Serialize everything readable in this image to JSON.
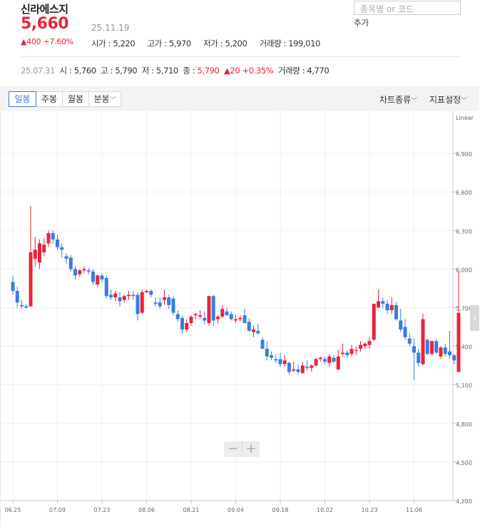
{
  "stock": {
    "name": "신라에스지",
    "price": "5,660",
    "date": "25.11.19",
    "change": "▲400 +7.60%",
    "open": "시가 : 5,220",
    "high": "고가 : 5,970",
    "low": "저가 : 5,200",
    "volume": "거래량 : 199,010"
  },
  "search": {
    "placeholder": "종목명 or 코드",
    "add_label": "추가"
  },
  "recent": {
    "date": "25.07.31",
    "open": "시 : 5,760",
    "high": "고 : 5,790",
    "low": "저 : 5,710",
    "close_label": "종 : ",
    "close_value": "5,790",
    "change": "▲20 +0.35%",
    "volume": "거래량 : 4,770"
  },
  "tabs": [
    "일봉",
    "주봉",
    "월봉",
    "분봉"
  ],
  "tools": {
    "chart_type": "차트종류",
    "indicators": "지표설정"
  },
  "zoom": {
    "out": "−",
    "in": "+"
  },
  "colors": {
    "up": "#e8243b",
    "down": "#3a7ddf",
    "accent": "#3c7bd8"
  },
  "chart_data": {
    "type": "candlestick",
    "scale_label": "Linear",
    "ylim": [
      4200,
      7200
    ],
    "yticks": [
      4200,
      4500,
      4800,
      5100,
      5400,
      5700,
      6000,
      6300,
      6600,
      6900
    ],
    "ytick_labels": [
      "4,200",
      "4,500",
      "4,800",
      "5,100",
      "5,400",
      "5,700",
      "6,000",
      "6,300",
      "6,600",
      "6,900"
    ],
    "xtick_labels": [
      {
        "label": "06.25",
        "index": 0
      },
      {
        "label": "07.09",
        "index": 10
      },
      {
        "label": "07.23",
        "index": 20
      },
      {
        "label": "08.06",
        "index": 30
      },
      {
        "label": "08.21",
        "index": 40
      },
      {
        "label": "09.04",
        "index": 50
      },
      {
        "label": "09.18",
        "index": 60
      },
      {
        "label": "10.02",
        "index": 70
      },
      {
        "label": "10.23",
        "index": 80
      },
      {
        "label": "11.06",
        "index": 90
      }
    ],
    "candles": [
      [
        5900,
        5950,
        5800,
        5830
      ],
      [
        5830,
        5860,
        5700,
        5740
      ],
      [
        5720,
        5760,
        5690,
        5710
      ],
      [
        5710,
        5730,
        5690,
        5700
      ],
      [
        5710,
        6490,
        5710,
        6130
      ],
      [
        6080,
        6250,
        6020,
        6150
      ],
      [
        6050,
        6230,
        6000,
        6200
      ],
      [
        6130,
        6240,
        6100,
        6190
      ],
      [
        6200,
        6300,
        6170,
        6280
      ],
      [
        6280,
        6300,
        6200,
        6230
      ],
      [
        6230,
        6270,
        6150,
        6170
      ],
      [
        6170,
        6200,
        6090,
        6150
      ],
      [
        6100,
        6120,
        6040,
        6080
      ],
      [
        6090,
        6110,
        5980,
        6000
      ],
      [
        6000,
        6020,
        5920,
        5950
      ],
      [
        5960,
        6000,
        5940,
        5990
      ],
      [
        5990,
        6020,
        5970,
        6000
      ],
      [
        5990,
        6010,
        5960,
        5980
      ],
      [
        5980,
        6000,
        5880,
        5900
      ],
      [
        5880,
        5960,
        5860,
        5950
      ],
      [
        5950,
        5970,
        5900,
        5920
      ],
      [
        5930,
        5950,
        5770,
        5790
      ],
      [
        5800,
        5840,
        5760,
        5780
      ],
      [
        5780,
        5830,
        5750,
        5810
      ],
      [
        5780,
        5820,
        5710,
        5750
      ],
      [
        5760,
        5800,
        5740,
        5790
      ],
      [
        5790,
        5830,
        5760,
        5800
      ],
      [
        5800,
        5830,
        5760,
        5790
      ],
      [
        5800,
        5820,
        5600,
        5650
      ],
      [
        5660,
        5840,
        5650,
        5820
      ],
      [
        5820,
        5840,
        5810,
        5830
      ],
      [
        5830,
        5840,
        5780,
        5800
      ],
      [
        5740,
        5780,
        5710,
        5730
      ],
      [
        5740,
        5780,
        5690,
        5710
      ],
      [
        5760,
        5840,
        5720,
        5780
      ],
      [
        5780,
        5800,
        5690,
        5720
      ],
      [
        5770,
        5790,
        5640,
        5660
      ],
      [
        5650,
        5680,
        5590,
        5610
      ],
      [
        5620,
        5640,
        5500,
        5530
      ],
      [
        5530,
        5610,
        5510,
        5580
      ],
      [
        5580,
        5640,
        5560,
        5630
      ],
      [
        5640,
        5660,
        5610,
        5650
      ],
      [
        5630,
        5680,
        5610,
        5640
      ],
      [
        5620,
        5670,
        5570,
        5600
      ],
      [
        5580,
        5790,
        5560,
        5790
      ],
      [
        5790,
        5800,
        5560,
        5600
      ],
      [
        5610,
        5640,
        5580,
        5630
      ],
      [
        5630,
        5720,
        5620,
        5690
      ],
      [
        5670,
        5700,
        5640,
        5640
      ],
      [
        5650,
        5670,
        5600,
        5610
      ],
      [
        5600,
        5640,
        5580,
        5610
      ],
      [
        5610,
        5640,
        5590,
        5620
      ],
      [
        5640,
        5690,
        5580,
        5580
      ],
      [
        5590,
        5620,
        5510,
        5520
      ],
      [
        5510,
        5560,
        5470,
        5530
      ],
      [
        5520,
        5570,
        5490,
        5500
      ],
      [
        5450,
        5470,
        5380,
        5380
      ],
      [
        5380,
        5440,
        5290,
        5320
      ],
      [
        5330,
        5360,
        5290,
        5310
      ],
      [
        5300,
        5340,
        5270,
        5290
      ],
      [
        5300,
        5350,
        5240,
        5260
      ],
      [
        5260,
        5330,
        5240,
        5290
      ],
      [
        5270,
        5280,
        5180,
        5200
      ],
      [
        5210,
        5280,
        5200,
        5220
      ],
      [
        5220,
        5260,
        5180,
        5200
      ],
      [
        5190,
        5280,
        5190,
        5250
      ],
      [
        5240,
        5290,
        5210,
        5230
      ],
      [
        5230,
        5260,
        5200,
        5250
      ],
      [
        5250,
        5310,
        5240,
        5300
      ],
      [
        5300,
        5320,
        5280,
        5310
      ],
      [
        5300,
        5320,
        5260,
        5280
      ],
      [
        5270,
        5340,
        5240,
        5320
      ],
      [
        5310,
        5330,
        5270,
        5280
      ],
      [
        5220,
        5370,
        5210,
        5320
      ],
      [
        5340,
        5420,
        5320,
        5350
      ],
      [
        5350,
        5370,
        5310,
        5330
      ],
      [
        5340,
        5410,
        5320,
        5380
      ],
      [
        5370,
        5400,
        5330,
        5370
      ],
      [
        5380,
        5440,
        5360,
        5410
      ],
      [
        5400,
        5430,
        5380,
        5420
      ],
      [
        5410,
        5470,
        5380,
        5440
      ],
      [
        5450,
        5730,
        5440,
        5730
      ],
      [
        5700,
        5840,
        5700,
        5750
      ],
      [
        5750,
        5780,
        5690,
        5730
      ],
      [
        5730,
        5760,
        5650,
        5680
      ],
      [
        5680,
        5780,
        5650,
        5720
      ],
      [
        5720,
        5740,
        5600,
        5610
      ],
      [
        5600,
        5690,
        5510,
        5530
      ],
      [
        5550,
        5610,
        5450,
        5470
      ],
      [
        5460,
        5500,
        5400,
        5420
      ],
      [
        5400,
        5460,
        5140,
        5350
      ],
      [
        5350,
        5380,
        5240,
        5270
      ],
      [
        5260,
        5650,
        5250,
        5610
      ],
      [
        5450,
        5460,
        5330,
        5340
      ],
      [
        5340,
        5440,
        5330,
        5440
      ],
      [
        5440,
        5460,
        5340,
        5350
      ],
      [
        5320,
        5400,
        5300,
        5390
      ],
      [
        5390,
        5420,
        5320,
        5340
      ],
      [
        5360,
        5520,
        5300,
        5330
      ],
      [
        5330,
        5340,
        5260,
        5290
      ],
      [
        5200,
        5980,
        5200,
        5660
      ]
    ]
  }
}
